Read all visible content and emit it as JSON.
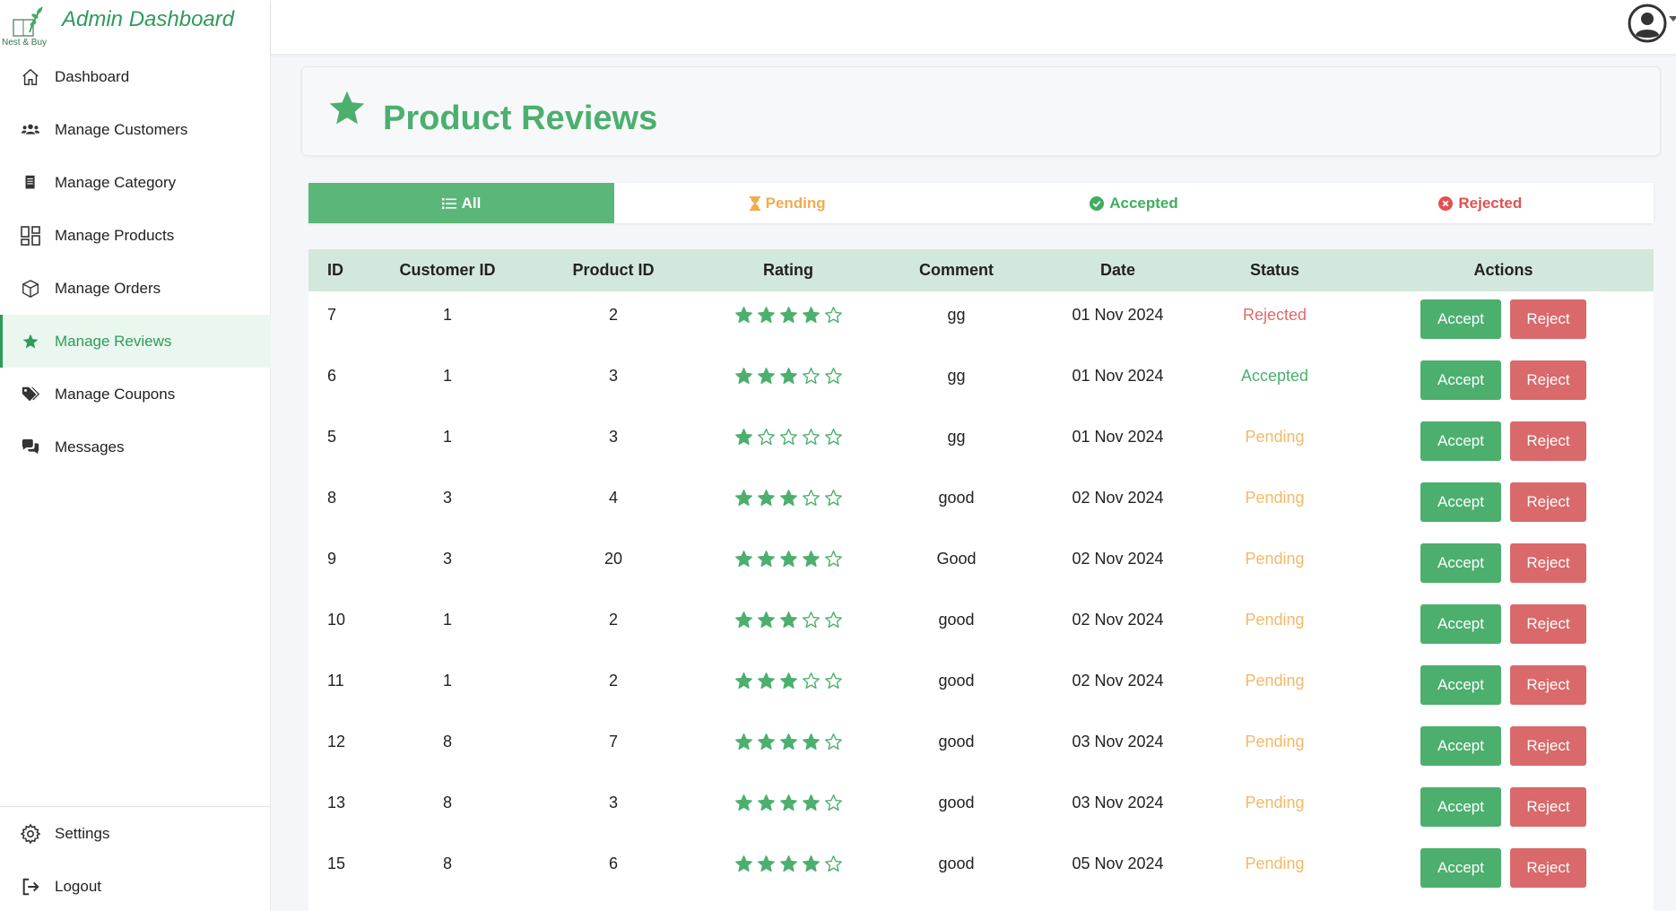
{
  "brand": {
    "logo_text": "Nest & Buy",
    "title": "Admin Dashboard"
  },
  "sidebar": {
    "items": [
      {
        "label": "Dashboard",
        "icon": "home-icon",
        "active": false
      },
      {
        "label": "Manage Customers",
        "icon": "users-icon",
        "active": false
      },
      {
        "label": "Manage Category",
        "icon": "document-icon",
        "active": false
      },
      {
        "label": "Manage Products",
        "icon": "grid-icon",
        "active": false
      },
      {
        "label": "Manage Orders",
        "icon": "box-icon",
        "active": false
      },
      {
        "label": "Manage Reviews",
        "icon": "star-icon",
        "active": true
      },
      {
        "label": "Manage Coupons",
        "icon": "tags-icon",
        "active": false
      },
      {
        "label": "Messages",
        "icon": "chat-icon",
        "active": false
      }
    ],
    "bottom": [
      {
        "label": "Settings",
        "icon": "gear-icon"
      },
      {
        "label": "Logout",
        "icon": "logout-icon"
      }
    ]
  },
  "topbar": {
    "avatar_icon": "user-circle-icon"
  },
  "page": {
    "title": "Product Reviews",
    "title_icon": "star-icon"
  },
  "tabs": [
    {
      "label": "All",
      "icon": "list-icon",
      "active": true
    },
    {
      "label": "Pending",
      "icon": "hourglass-icon",
      "active": false
    },
    {
      "label": "Accepted",
      "icon": "check-circle-icon",
      "active": false
    },
    {
      "label": "Rejected",
      "icon": "x-circle-icon",
      "active": false
    }
  ],
  "table": {
    "headers": [
      "ID",
      "Customer ID",
      "Product ID",
      "Rating",
      "Comment",
      "Date",
      "Status",
      "Actions"
    ],
    "accept_label": "Accept",
    "reject_label": "Reject",
    "rows": [
      {
        "id": "7",
        "customer_id": "1",
        "product_id": "2",
        "rating": 4,
        "comment": "gg",
        "date": "01 Nov 2024",
        "status": "Rejected"
      },
      {
        "id": "6",
        "customer_id": "1",
        "product_id": "3",
        "rating": 3,
        "comment": "gg",
        "date": "01 Nov 2024",
        "status": "Accepted"
      },
      {
        "id": "5",
        "customer_id": "1",
        "product_id": "3",
        "rating": 1,
        "comment": "gg",
        "date": "01 Nov 2024",
        "status": "Pending"
      },
      {
        "id": "8",
        "customer_id": "3",
        "product_id": "4",
        "rating": 3,
        "comment": "good",
        "date": "02 Nov 2024",
        "status": "Pending"
      },
      {
        "id": "9",
        "customer_id": "3",
        "product_id": "20",
        "rating": 4,
        "comment": "Good",
        "date": "02 Nov 2024",
        "status": "Pending"
      },
      {
        "id": "10",
        "customer_id": "1",
        "product_id": "2",
        "rating": 3,
        "comment": "good",
        "date": "02 Nov 2024",
        "status": "Pending"
      },
      {
        "id": "11",
        "customer_id": "1",
        "product_id": "2",
        "rating": 3,
        "comment": "good",
        "date": "02 Nov 2024",
        "status": "Pending"
      },
      {
        "id": "12",
        "customer_id": "8",
        "product_id": "7",
        "rating": 4,
        "comment": "good",
        "date": "03 Nov 2024",
        "status": "Pending"
      },
      {
        "id": "13",
        "customer_id": "8",
        "product_id": "3",
        "rating": 4,
        "comment": "good",
        "date": "03 Nov 2024",
        "status": "Pending"
      },
      {
        "id": "15",
        "customer_id": "8",
        "product_id": "6",
        "rating": 4,
        "comment": "good",
        "date": "05 Nov 2024",
        "status": "Pending"
      }
    ]
  },
  "colors": {
    "accent": "#4caf6e",
    "pending": "#f2b968",
    "rejected": "#e06a6a",
    "header_row": "#d3e8dc"
  }
}
